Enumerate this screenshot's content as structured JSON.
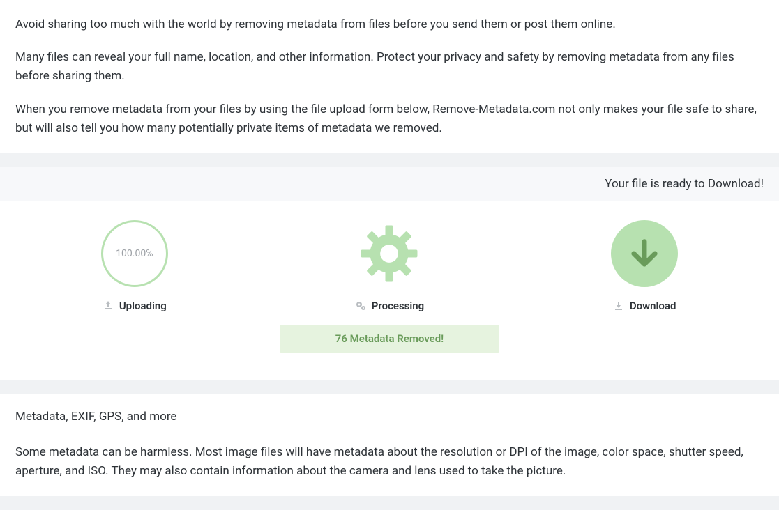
{
  "intro": {
    "p1": "Avoid sharing too much with the world by removing metadata from files before you send them or post them online.",
    "p2": "Many files can reveal your full name, location, and other information. Protect your privacy and safety by removing metadata from any files before sharing them.",
    "p3": "When you remove metadata from your files by using the file upload form below, Remove-Metadata.com not only makes your file safe to share, but will also tell you how many potentially private items of metadata we removed."
  },
  "status": {
    "ready_text": "Your file is ready to Download!"
  },
  "steps": {
    "upload": {
      "percent": "100.00%",
      "label": "Uploading"
    },
    "processing": {
      "label": "Processing",
      "badge": "76 Metadata Removed!"
    },
    "download": {
      "label": "Download"
    }
  },
  "info": {
    "heading": "Metadata, EXIF, GPS, and more",
    "p1": "Some metadata can be harmless. Most image files will have metadata about the resolution or DPI of the image, color space, shutter speed, aperture, and ISO. They may also contain information about the camera and lens used to take the picture."
  },
  "colors": {
    "accent_light": "#b7e1b0",
    "accent_dark": "#699b5a"
  }
}
